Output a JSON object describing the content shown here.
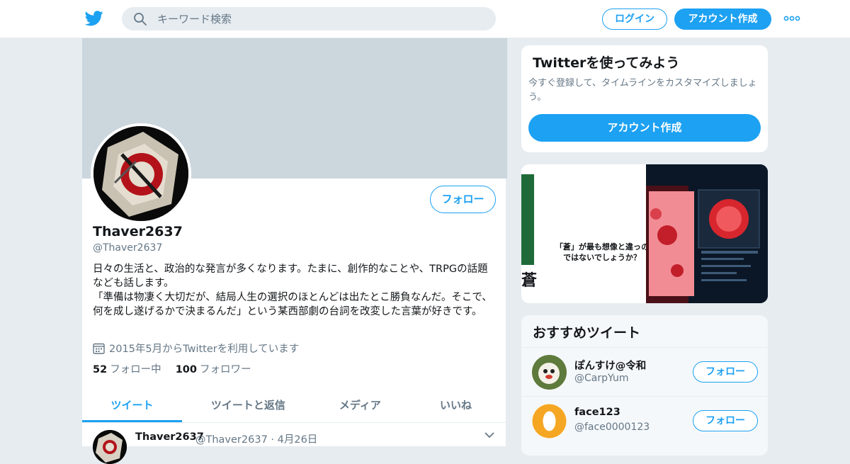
{
  "header": {
    "search_placeholder": "キーワード検索",
    "login_label": "ログイン",
    "signup_label": "アカウント作成",
    "brand_color": "#1da1f2"
  },
  "profile": {
    "follow_label": "フォロー",
    "name": "Thaver2637",
    "handle": "@Thaver2637",
    "bio": "日々の生活と、政治的な発言が多くなります。たまに、創作的なことや、TRPGの話題なども話します。\n「準備は物凄く大切だが、結局人生の選択のほとんどは出たとこ勝負なんだ。そこで、何を成し遂げるかで決まるんだ」という某西部劇の台詞を改変した言葉が好きです。",
    "joined": "2015年5月からTwitterを利用しています",
    "following_count": "52",
    "following_label": "フォロー中",
    "followers_count": "100",
    "followers_label": "フォロワー",
    "tabs": [
      "ツイート",
      "ツイートと返信",
      "メディア",
      "いいね"
    ],
    "tweet": {
      "name": "Thaver2637",
      "meta": "@Thaver2637 · 4月26日"
    }
  },
  "signup_card": {
    "title": "Twitterを使ってみよう",
    "description": "今すぐ登録して、タイムラインをカスタマイズしましょう。",
    "button": "アカウント作成"
  },
  "media": {
    "kanji": "蒼",
    "quote": "「蒼」が最も想像と違っのではないでしょうか？"
  },
  "recommendations": {
    "title": "おすすめツイート",
    "items": [
      {
        "name": "ぽんすけ@令和",
        "handle": "@CarpYum",
        "follow": "フォロー"
      },
      {
        "name": "face123",
        "handle": "@face0000123",
        "follow": "フォロー"
      }
    ]
  }
}
